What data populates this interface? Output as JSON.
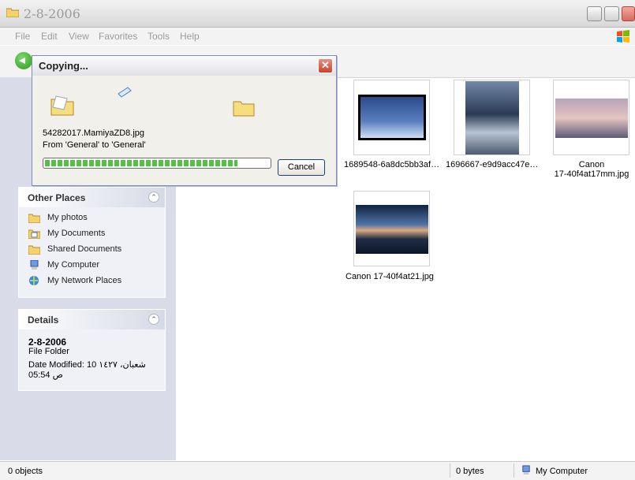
{
  "window": {
    "title": "2-8-2006"
  },
  "menu": [
    "File",
    "Edit",
    "View",
    "Favorites",
    "Tools",
    "Help"
  ],
  "other_places": {
    "header": "Other Places",
    "items": [
      {
        "label": "My photos",
        "icon": "folder-icon"
      },
      {
        "label": "My Documents",
        "icon": "my-documents-icon"
      },
      {
        "label": "Shared Documents",
        "icon": "folder-icon"
      },
      {
        "label": "My Computer",
        "icon": "computer-icon"
      },
      {
        "label": "My Network Places",
        "icon": "network-icon"
      }
    ]
  },
  "details": {
    "header": "Details",
    "name": "2-8-2006",
    "type": "File Folder",
    "modified_line1": "Date Modified: 10 شعبان، ١٤٢٧",
    "modified_line2": "05:54 ص"
  },
  "files": [
    {
      "caption": "1689548-6a8dc5bb3af…"
    },
    {
      "caption": "1696667-e9d9acc47e…"
    },
    {
      "caption_line1": "Canon",
      "caption_line2": "17-40f4at17mm.jpg"
    },
    {
      "caption": "Canon 17-40f4at21.jpg"
    }
  ],
  "status": {
    "objects": "0 objects",
    "size": "0 bytes",
    "location": "My Computer"
  },
  "dialog": {
    "title": "Copying...",
    "filename": "54282017.MamiyaZD8.jpg",
    "from_to": "From 'General' to 'General'",
    "progress": 0.86,
    "cancel_label": "Cancel"
  }
}
